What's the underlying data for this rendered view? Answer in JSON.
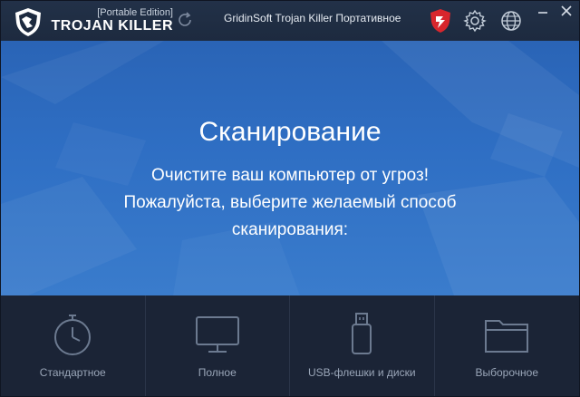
{
  "header": {
    "edition": "[Portable Edition]",
    "brand": "TROJAN KILLER",
    "app_title": "GridinSoft Trojan Killer Портативное",
    "icons": [
      "logo-icon",
      "refresh-icon",
      "shield-icon",
      "gear-icon",
      "globe-icon",
      "minimize-icon",
      "close-icon"
    ]
  },
  "hero": {
    "title": "Сканирование",
    "line1": "Очистите ваш компьютер от угроз!",
    "line2": "Пожалуйста, выберите желаемый способ",
    "line3": "сканирования:"
  },
  "options": [
    {
      "label": "Стандартное",
      "icon": "stopwatch-icon"
    },
    {
      "label": "Полное",
      "icon": "monitor-icon"
    },
    {
      "label": "USB-флешки и диски",
      "icon": "usb-drive-icon"
    },
    {
      "label": "Выборочное",
      "icon": "folder-icon"
    }
  ],
  "colors": {
    "titlebar": "#1d2a3f",
    "hero_top": "#2a64b6",
    "hero_bottom": "#3a7ccc",
    "options_bg": "#1b2436",
    "shield_red": "#d8262d",
    "option_icon": "#6c7a90"
  }
}
